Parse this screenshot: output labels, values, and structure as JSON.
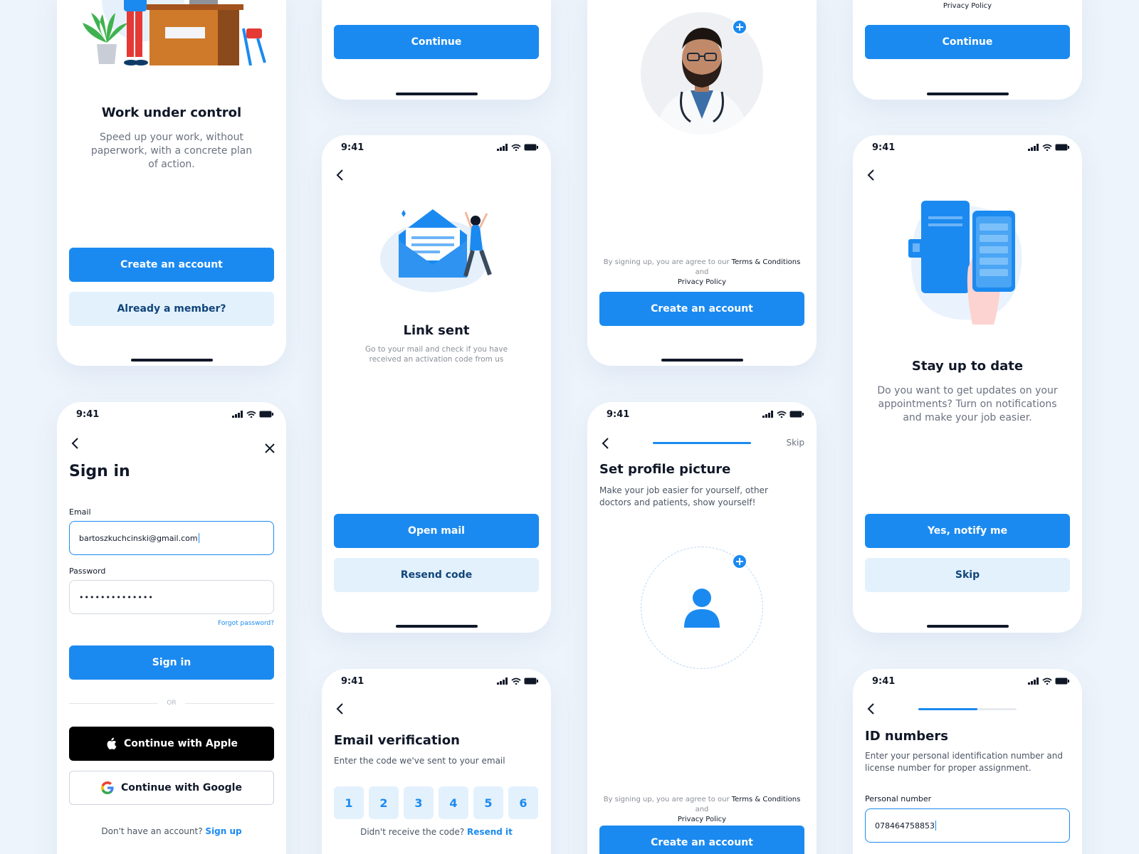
{
  "status": {
    "time": "9:41"
  },
  "welcome": {
    "title": "Work under control",
    "subtitle": "Speed up your work, without paperwork, with a concrete plan of action.",
    "create_label": "Create an account",
    "member_label": "Already a member?"
  },
  "signin": {
    "title": "Sign in",
    "email_label": "Email",
    "email_value": "bartoszkuchcinski@gmail.com",
    "password_label": "Password",
    "password_value": "••••••••••••••",
    "forgot_label": "Forgot password?",
    "signin_label": "Sign in",
    "or_label": "OR",
    "apple_label": "Continue with Apple",
    "google_label": "Continue with Google",
    "no_account_text": "Don't have an account?",
    "signup_label": "Sign up"
  },
  "top_continue": {
    "continue_label": "Continue"
  },
  "link_sent": {
    "title": "Link sent",
    "subtitle": "Go to your mail and check if you have received an activation code from us",
    "open_mail_label": "Open mail",
    "resend_label": "Resend code"
  },
  "email_verification": {
    "title": "Email verification",
    "subtitle": "Enter the code we've sent to your email",
    "digits": [
      "1",
      "2",
      "3",
      "4",
      "5",
      "6"
    ],
    "no_code_text": "Didn't receive the code?",
    "resend_label": "Resend it"
  },
  "terms": {
    "prefix": "By signing up, you are agree to our",
    "terms_link": "Terms & Conditions",
    "and_text": "and",
    "privacy_link": "Privacy Policy"
  },
  "photo_screen": {
    "create_label": "Create an account"
  },
  "profile_picture": {
    "skip_label": "Skip",
    "progress": 1.0,
    "title": "Set profile picture",
    "subtitle": "Make your job easier for yourself, other doctors and patients, show yourself!",
    "create_label": "Create an account"
  },
  "top_privacy": {
    "privacy_label": "Privacy Policy",
    "continue_label": "Continue"
  },
  "stay_updated": {
    "title": "Stay up to date",
    "subtitle": "Do you want to get updates on your appointments? Turn on notifications and make your job easier.",
    "notify_label": "Yes, notify me",
    "skip_label": "Skip"
  },
  "id_numbers": {
    "progress": 0.6,
    "title": "ID numbers",
    "subtitle": "Enter your personal identification number and license number for proper assignment.",
    "personal_label": "Personal number",
    "personal_value": "078464758853"
  },
  "colors": {
    "accent": "#1b8af0",
    "accent_light": "#e3f1fd",
    "text": "#101828",
    "muted": "#6b7280",
    "background": "#eef4fb"
  },
  "icons": [
    "back-chevron-icon",
    "close-icon",
    "apple-icon",
    "google-icon",
    "plus-icon",
    "user-icon",
    "signal-icon",
    "wifi-icon",
    "battery-icon"
  ]
}
